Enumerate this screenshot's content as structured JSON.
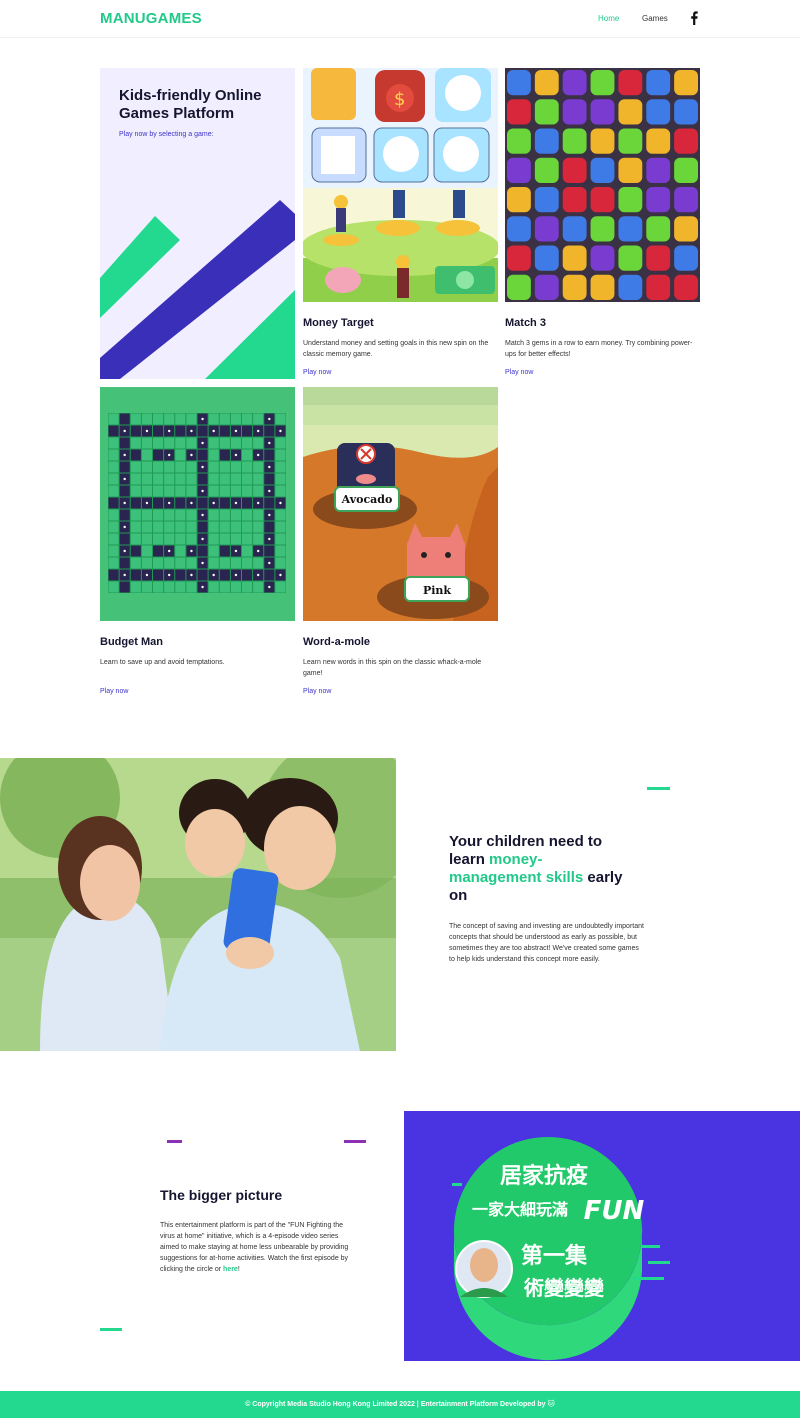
{
  "header": {
    "logo": "MANUGAMES",
    "nav": {
      "home": "Home",
      "games": "Games"
    },
    "social_icon": "facebook-icon"
  },
  "intro": {
    "title": "Kids-friendly Online Games Platform",
    "subtitle": "Play now by selecting a game:"
  },
  "games": [
    {
      "title": "Money Target",
      "description": "Understand money and setting goals in this new spin on the classic memory game.",
      "link": "Play now"
    },
    {
      "title": "Match 3",
      "description": "Match 3 gems in a row to earn money. Try combining power-ups for better effects!",
      "link": "Play now"
    },
    {
      "title": "Budget Man",
      "description": "Learn to save up and avoid temptations.",
      "link": "Play now"
    },
    {
      "title": "Word-a-mole",
      "description": "Learn new words in this spin on the classic whack-a-mole game!",
      "link": "Play now",
      "art_labels": {
        "top": "Avocado",
        "bottom": "Pink"
      }
    }
  ],
  "family": {
    "heading_pre": "Your children need to learn ",
    "heading_highlight": "money-management skills",
    "heading_post": " early on",
    "body": "The concept of saving and investing are undoubtedly important concepts that should be understood as early as possible, but sometimes they are too abstract! We've created some games to help kids understand this concept more easily."
  },
  "bigger": {
    "title": "The bigger picture",
    "body": "This entertainment platform is part of the \"FUN Fighting the virus at home\" initiative, which is a 4-episode video series aimed to make staying at home less unbearable by providing suggestions for at-home activities. Watch the first episode by clicking the circle or ",
    "link": "here",
    "tail": "!",
    "video_lines": [
      "居家抗疫",
      "一家大細玩滿",
      "FUN",
      "第一集",
      "術變變變"
    ]
  },
  "footer": {
    "text": "© Copyright Media Studio Hong Kong Limited 2022 | Entertainment Platform Developed by 🐱"
  },
  "colors": {
    "brand_green": "#22c98a",
    "brand_purple": "#3d33c9",
    "panel_violet": "#4a33e0"
  }
}
